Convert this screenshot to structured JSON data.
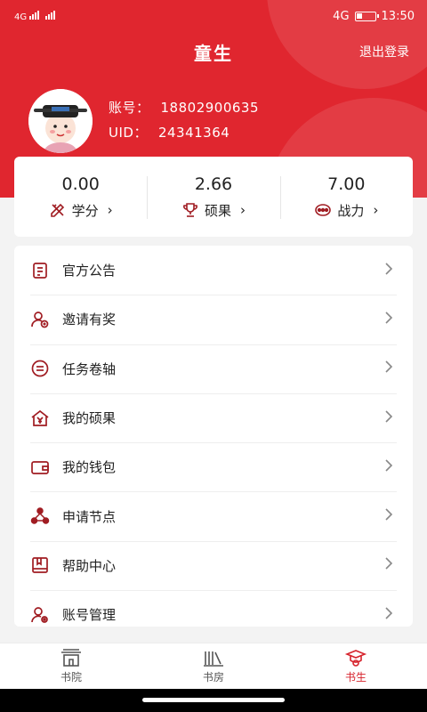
{
  "status": {
    "signal_left": "4G",
    "network": "4G",
    "time": "13:50"
  },
  "header": {
    "title": "童生",
    "logout": "退出登录"
  },
  "account": {
    "label_account": "账号：",
    "account_no": "18802900635",
    "label_uid": "UID：",
    "uid": "24341364"
  },
  "stats": [
    {
      "value": "0.00",
      "label": "学分",
      "icon": "pen-ruler-icon"
    },
    {
      "value": "2.66",
      "label": "硕果",
      "icon": "trophy-icon"
    },
    {
      "value": "7.00",
      "label": "战力",
      "icon": "power-icon"
    }
  ],
  "menu": [
    {
      "label": "官方公告",
      "icon": "notice-icon"
    },
    {
      "label": "邀请有奖",
      "icon": "invite-icon"
    },
    {
      "label": "任务卷轴",
      "icon": "task-icon"
    },
    {
      "label": "我的硕果",
      "icon": "house-yen-icon"
    },
    {
      "label": "我的钱包",
      "icon": "wallet-icon"
    },
    {
      "label": "申请节点",
      "icon": "node-icon"
    },
    {
      "label": "帮助中心",
      "icon": "help-book-icon"
    },
    {
      "label": "账号管理",
      "icon": "account-settings-icon"
    }
  ],
  "tabs": [
    {
      "label": "书院",
      "icon": "academy-icon",
      "active": false
    },
    {
      "label": "书房",
      "icon": "books-icon",
      "active": false
    },
    {
      "label": "书生",
      "icon": "scholar-icon",
      "active": true
    }
  ],
  "colors": {
    "brand": "#e0262f",
    "icon": "#a01c22",
    "active_tab": "#d6232c"
  }
}
